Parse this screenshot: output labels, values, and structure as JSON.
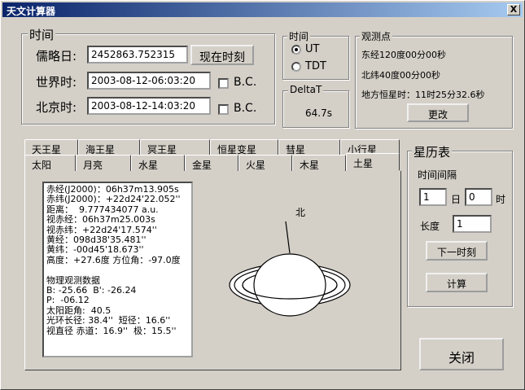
{
  "window": {
    "title": "天文计算器",
    "close_glyph": "X"
  },
  "time_group": {
    "title": "时间",
    "julian_label": "儒略日:",
    "julian_value": "2452863.752315",
    "now_button": "现在时刻",
    "ut_label": "世界时:",
    "ut_value": "2003-08-12-06:03:20",
    "bj_label": "北京时:",
    "bj_value": "2003-08-12-14:03:20",
    "bc_label": "B.C."
  },
  "timescale": {
    "title": "时间",
    "options": [
      "UT",
      "TDT"
    ],
    "selected": "UT"
  },
  "deltat": {
    "title": "DeltaT",
    "value": "64.7s"
  },
  "observer": {
    "title": "观测点",
    "longitude": "东经120度00分00秒",
    "latitude": "北纬40度00分00秒",
    "sidereal": "地方恒星时：11时25分32.6秒",
    "change_button": "更改"
  },
  "tabs_back": [
    "天王星",
    "海王星",
    "冥王星",
    "恒星变星",
    "彗星",
    "小行星"
  ],
  "tabs_front": [
    "太阳",
    "月亮",
    "水星",
    "金星",
    "火星",
    "木星",
    "土星"
  ],
  "active_tab": "土星",
  "planet_info": [
    "赤经(J2000)：06h37m13.905s",
    "赤纬(J2000)：+22d24'22.052''",
    "距离：  9.777434077 a.u.",
    "视赤经：06h37m25.003s",
    "视赤纬：+22d24'17.574''",
    "黄经：098d38'35.481''",
    "黄纬：-00d45'18.673''",
    "高度：+27.6度 方位角：-97.0度",
    "",
    "物理观测数据",
    "B: -25.66  B': -26.24",
    "P:  -06.12",
    "太阳距角:  40.5",
    "光环长径: 38.4''  短径：16.6''",
    "视直径 赤道：16.9''  极：15.5''"
  ],
  "diagram": {
    "north_label": "北"
  },
  "ephemeris": {
    "title": "星历表",
    "interval_label": "时间间隔",
    "day_value": "1",
    "day_unit": "日",
    "hour_value": "0",
    "hour_unit": "时",
    "length_label": "长度",
    "length_value": "1",
    "next_button": "下一时刻",
    "compute_button": "计算"
  },
  "close_button": "关闭"
}
